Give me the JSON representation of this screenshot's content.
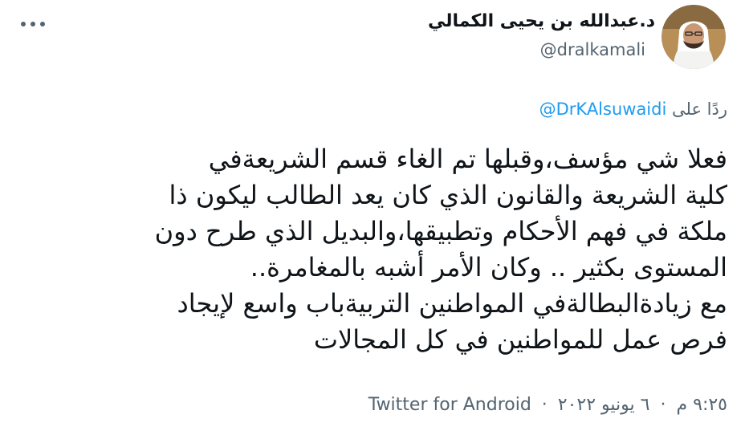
{
  "author": {
    "name": "د.عبدالله بن يحيى الكمالي",
    "handle": "@dralkamali"
  },
  "reply": {
    "prefix": "ردًا على",
    "mention": "@DrKAlsuwaidi"
  },
  "tweet": {
    "lines": [
      "فعلا شي مؤسف،وقبلها تم الغاء قسم الشريعةفي",
      "كلية الشريعة والقانون الذي كان يعد الطالب ليكون ذا",
      "ملكة في فهم الأحكام وتطبيقها،والبديل الذي طرح دون",
      "المستوى بكثير .. وكان الأمر أشبه بالمغامرة..",
      "مع زيادةالبطالةفي المواطنين التربيةباب واسع لإيجاد",
      "فرص عمل للمواطنين في كل المجالات"
    ]
  },
  "meta": {
    "time": "٩:٢٥ م",
    "date": "٦ يونيو ٢٠٢٢",
    "source": "Twitter for Android",
    "separator": "·"
  },
  "icons": {
    "more": "more-horizontal-icon"
  }
}
